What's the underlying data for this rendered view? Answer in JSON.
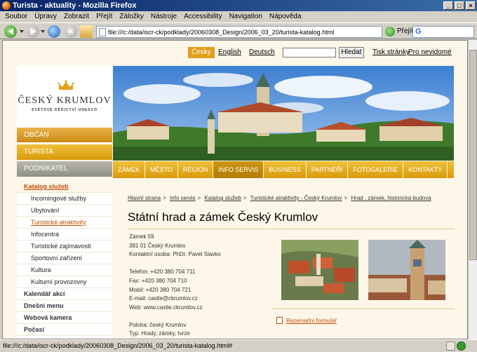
{
  "window": {
    "title": "Turista - aktuality - Mozilla Firefox"
  },
  "menubar": [
    "Soubor",
    "Úpravy",
    "Zobrazit",
    "Přejít",
    "Záložky",
    "Nástroje",
    "Accessibility",
    "Navigation",
    "Nápověda"
  ],
  "toolbar": {
    "url": "file:///c:/data/iscr-ck/podklady/20060308_Design/2006_03_20/turista-katalog.html",
    "go_label": "Přejít",
    "search_placeholder": ""
  },
  "site": {
    "languages": [
      {
        "label": "Česky",
        "active": true
      },
      {
        "label": "English",
        "active": false
      },
      {
        "label": "Deutsch",
        "active": false
      }
    ],
    "search_button": "Hledat",
    "links": [
      "Tisk stránky",
      "Pro nevidomé"
    ],
    "logo": {
      "title": "ČESKÝ KRUMLOV",
      "subtitle": "SVĚTOVÉ DĚDICTVÍ UNESCO"
    },
    "audience_tabs": [
      "OBČAN",
      "TURISTA",
      "PODNIKATEL"
    ],
    "main_nav": [
      {
        "label": "ZÁMEK",
        "active": false
      },
      {
        "label": "MĚSTO",
        "active": false
      },
      {
        "label": "REGION",
        "active": false
      },
      {
        "label": "INFO SERVIS",
        "active": true
      },
      {
        "label": "BUSINESS",
        "active": false
      },
      {
        "label": "PARTNEŘI",
        "active": false
      },
      {
        "label": "FOTOGALERIE",
        "active": false
      },
      {
        "label": "KONTAKTY",
        "active": false
      }
    ],
    "sidebar": {
      "heading": "Katalog služeb",
      "sub_items": [
        {
          "label": "Incomingové služby",
          "selected": false
        },
        {
          "label": "Ubytování",
          "selected": false
        },
        {
          "label": "Turistické atraktivity",
          "selected": true
        },
        {
          "label": "Infocentra",
          "selected": false
        },
        {
          "label": "Turistické zajímavosti",
          "selected": false
        },
        {
          "label": "Sportovní zařízení",
          "selected": false
        },
        {
          "label": "Kultura",
          "selected": false
        },
        {
          "label": "Kulturní provozovny",
          "selected": false
        }
      ],
      "top_items": [
        "Kalendář akcí",
        "Dnešní menu",
        "Webová kamera",
        "Počasí"
      ]
    },
    "breadcrumb": [
      "Hlavní strana",
      "Info servis",
      "Katalog služeb",
      "Turistické atraktivity - Český Krumlov",
      "Hrad , zámek, historická budova"
    ],
    "title": "Státní hrad a zámek Český Krumlov",
    "address": {
      "lines1": [
        "Zámek 59",
        "381 01 Český Krumlov",
        "Kontaktní osoba: PhDr. Pavel Slavko"
      ],
      "lines2": [
        "Telefon: +420 380 704 711",
        "Fax: +420 380 704 710",
        "Mobil: +420 380 704 721",
        "E-mail: castle@ckrumlov.cz",
        "Web: www.castle.ckrumlov.cz"
      ],
      "lines3": [
        "Poloha: český Krumlov",
        "Typ: Hrady, zámky, tvrze"
      ]
    },
    "reservation_link": "Rezervační formulář"
  },
  "status": {
    "text": "file:///c:/data/iscr-ck/podklady/20060308_Design/2006_03_20/turista-katalog.html#"
  },
  "colors": {
    "accent": "#e2a019",
    "link": "#c04a00",
    "background": "#fdf7e9"
  }
}
